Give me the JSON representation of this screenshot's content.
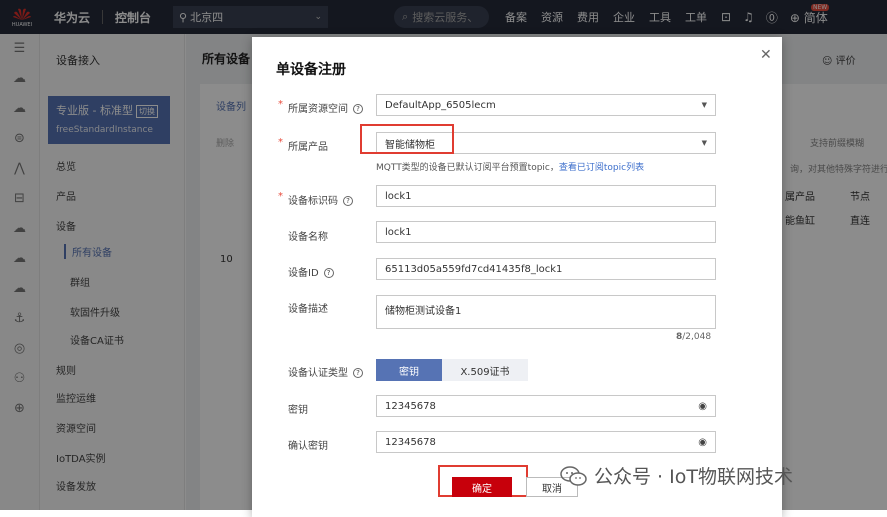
{
  "topbar": {
    "logo_text": "HUAWEI",
    "brand": "华为云",
    "console": "控制台",
    "region": "北京四",
    "search_placeholder": "搜索云服务、",
    "nav": [
      "备案",
      "资源",
      "费用",
      "企业",
      "工具",
      "工单"
    ],
    "new_badge": "NEW",
    "lang": "简体"
  },
  "sidebar": {
    "title": "设备接入",
    "edition_name": "专业版 - 标准型",
    "switch_label": "切换",
    "edition_id": "freeStandardInstance",
    "items": {
      "overview": "总览",
      "product": "产品",
      "device": "设备",
      "all_devices": "所有设备",
      "groups": "群组",
      "firmware": "软固件升级",
      "ca_cert": "设备CA证书",
      "rules": "规则",
      "ops": "监控运维",
      "resource_space": "资源空间",
      "iotda": "IoTDA实例",
      "provisioning": "设备发放"
    }
  },
  "main": {
    "title": "所有设备",
    "rate": "评价",
    "tab": "设备列",
    "delete": "删除",
    "search_hint": "支持前缀模糊",
    "hint_right": "询，对其他特殊字符进行",
    "col_product": "属产品",
    "col_node": "节点",
    "row_product": "能鱼缸",
    "row_node": "直连",
    "page_size": "10"
  },
  "dialog": {
    "title": "单设备注册",
    "resource_space_label": "所属资源空间",
    "resource_space_value": "DefaultApp_6505lecm",
    "product_label": "所属产品",
    "product_value": "智能储物柜",
    "hint_text": "MQTT类型的设备已默认订阅平台预置topic，",
    "hint_link": "查看已订阅topic列表",
    "node_id_label": "设备标识码",
    "node_id_value": "lock1",
    "device_name_label": "设备名称",
    "device_name_value": "lock1",
    "device_id_label": "设备ID",
    "device_id_value": "65113d05a559fd7cd41435f8_lock1",
    "desc_label": "设备描述",
    "desc_value": "储物柜测试设备1",
    "desc_counter_current": "8",
    "desc_counter_max": "/2,048",
    "auth_label": "设备认证类型",
    "auth_secret": "密钥",
    "auth_x509": "X.509证书",
    "secret_label": "密钥",
    "secret_value": "12345678",
    "confirm_secret_label": "确认密钥",
    "confirm_secret_value": "12345678",
    "ok": "确定",
    "cancel": "取消"
  },
  "watermark": "公众号 · IoT物联网技术",
  "colors": {
    "topbar": "#252b3a",
    "accent": "#5673b4",
    "primary_button": "#c7000b",
    "highlight_frame": "#e03c31"
  }
}
